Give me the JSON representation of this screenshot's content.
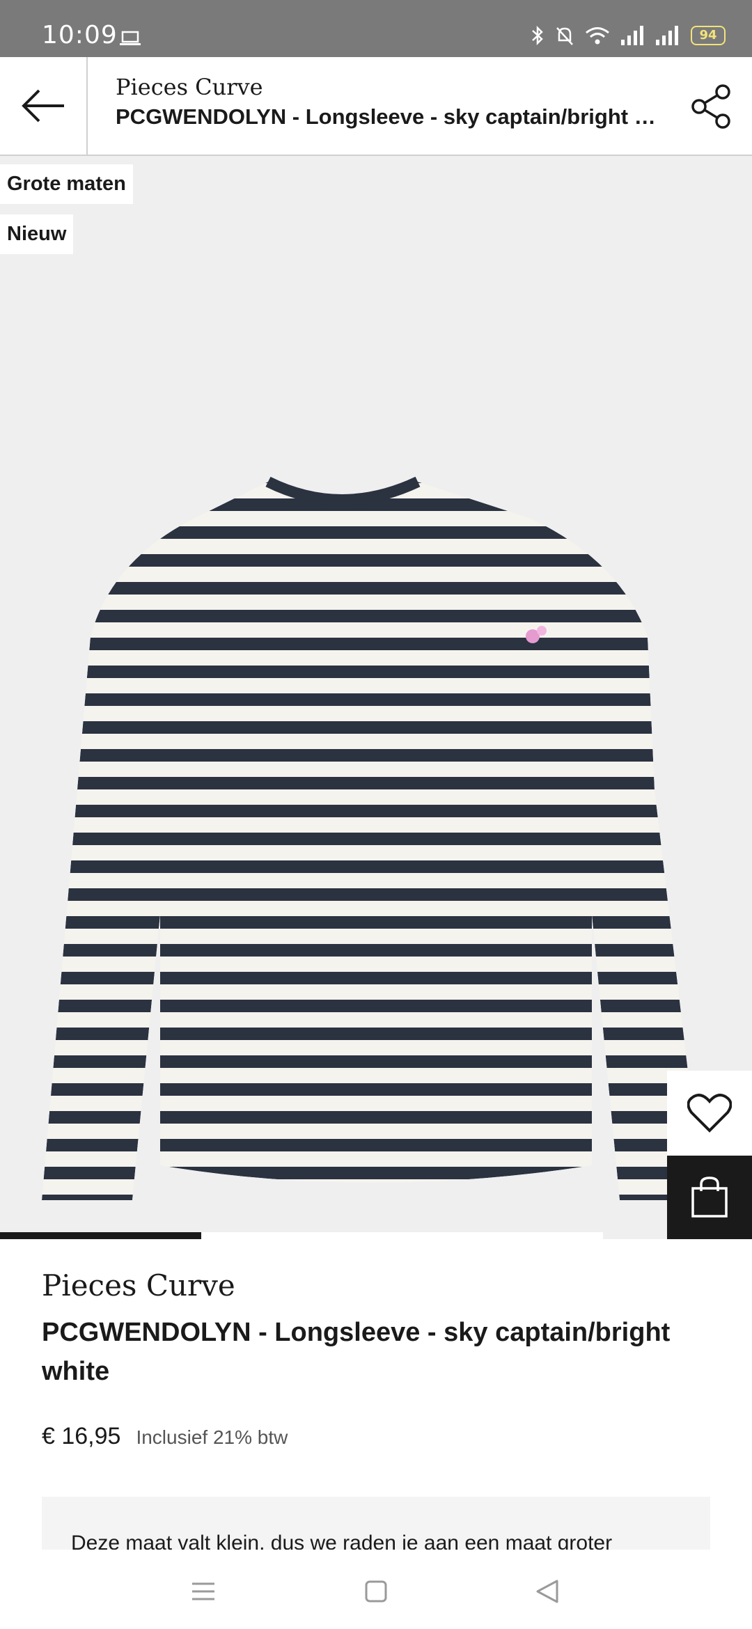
{
  "status_bar": {
    "time": "10:09",
    "battery": "94"
  },
  "header": {
    "brand": "Pieces Curve",
    "title": "PCGWENDOLYN - Longsleeve - sky captain/bright white"
  },
  "badges": [
    "Grote maten",
    "Nieuw"
  ],
  "product": {
    "brand": "Pieces Curve",
    "title": "PCGWENDOLYN - Longsleeve - sky captain/bright white",
    "price": "€ 16,95",
    "vat": "Inclusief 21% btw",
    "size_notice": "Deze maat valt klein, dus we raden je aan een maat groter"
  },
  "colors": {
    "stripe_dark": "#2b3240",
    "stripe_light": "#f5f3ee",
    "accent_dark": "#1a1a1a"
  },
  "carousel": {
    "current": 1,
    "total": 3
  }
}
